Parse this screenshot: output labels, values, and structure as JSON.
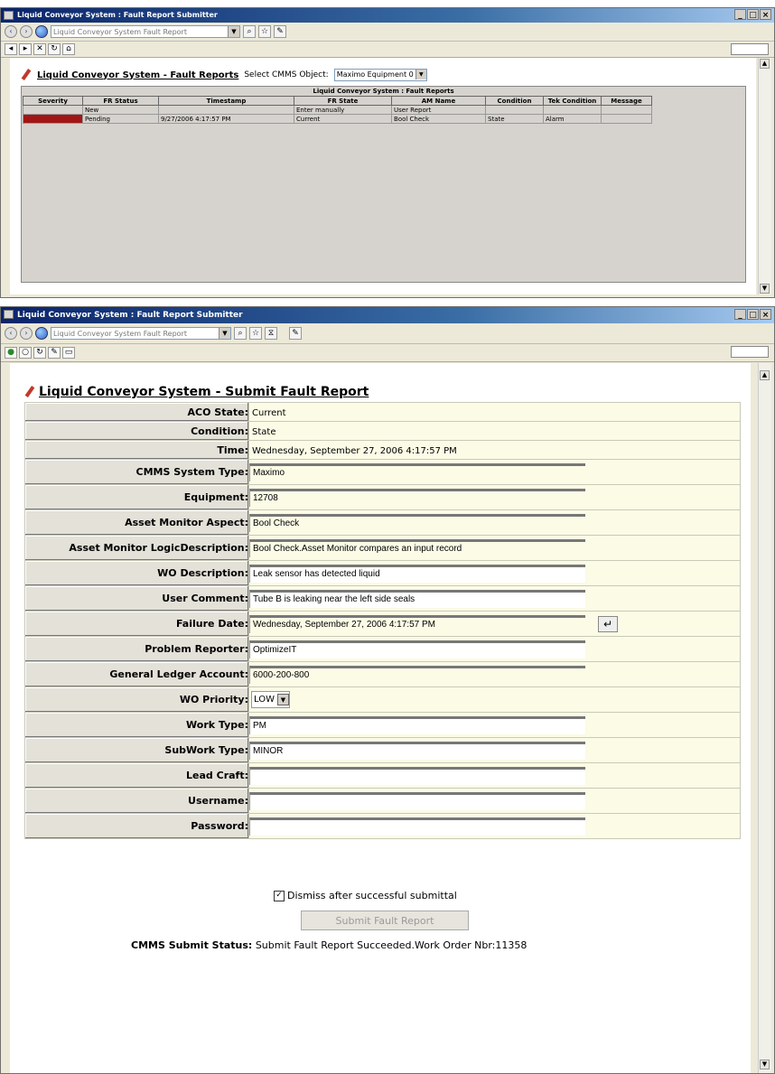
{
  "top_window": {
    "title": "Liquid Conveyor System : Fault Report Submitter",
    "address": "Liquid Conveyor System Fault Report",
    "page": {
      "title": "Liquid Conveyor System - Fault Reports",
      "select_label": "Select CMMS Object:",
      "select_value": "Maximo Equipment 0",
      "table_caption": "Liquid Conveyor System : Fault Reports",
      "columns": [
        "Severity",
        "FR Status",
        "Timestamp",
        "FR State",
        "AM Name",
        "Condition",
        "Tek Condition",
        "Message"
      ],
      "rows": [
        {
          "severity": "",
          "status": "New",
          "timestamp": "",
          "state": "Enter manually",
          "am_name": "User Report",
          "condition": "",
          "tek_condition": "",
          "message": ""
        },
        {
          "severity": "red",
          "status": "Pending",
          "timestamp": "9/27/2006 4:17:57 PM",
          "state": "Current",
          "am_name": "Bool Check",
          "condition": "State",
          "tek_condition": "Alarm",
          "message": ""
        }
      ]
    }
  },
  "bottom_window": {
    "title": "Liquid Conveyor System : Fault Report Submitter",
    "address": "Liquid Conveyor System Fault Report",
    "page_title": "Liquid Conveyor System - Submit Fault Report",
    "fields": {
      "aco_state": {
        "label": "ACO State:",
        "value": "Current"
      },
      "condition": {
        "label": "Condition:",
        "value": "State"
      },
      "time": {
        "label": "Time:",
        "value": "Wednesday, September 27, 2006 4:17:57 PM"
      },
      "cmms_system_type": {
        "label": "CMMS System Type:",
        "value": "Maximo"
      },
      "equipment": {
        "label": "Equipment:",
        "value": "12708"
      },
      "asset_monitor_aspect": {
        "label": "Asset Monitor Aspect:",
        "value": "Bool Check"
      },
      "asset_monitor_logic": {
        "label": "Asset Monitor LogicDescription:",
        "value": "Bool Check.Asset Monitor compares an input record"
      },
      "wo_description": {
        "label": "WO Description:",
        "value": "Leak sensor has detected liquid"
      },
      "user_comment": {
        "label": "User Comment:",
        "value": "Tube B is leaking near the left side seals"
      },
      "failure_date": {
        "label": "Failure Date:",
        "value": "Wednesday, September 27, 2006 4:17:57 PM"
      },
      "problem_reporter": {
        "label": "Problem Reporter:",
        "value": "OptimizeIT"
      },
      "gl_account": {
        "label": "General Ledger Account:",
        "value": "6000-200-800"
      },
      "wo_priority": {
        "label": "WO Priority:",
        "value": "LOW"
      },
      "work_type": {
        "label": "Work Type:",
        "value": "PM"
      },
      "subwork_type": {
        "label": "SubWork Type:",
        "value": "MINOR"
      },
      "lead_craft": {
        "label": "Lead Craft:",
        "value": ""
      },
      "username": {
        "label": "Username:",
        "value": ""
      },
      "password": {
        "label": "Password:",
        "value": ""
      }
    },
    "dismiss_label": "Dismiss after successful submittal",
    "dismiss_checked": true,
    "submit_label": "Submit Fault Report",
    "status_label": "CMMS Submit Status:",
    "status_value": "Submit Fault Report Succeeded.Work Order Nbr:11358"
  }
}
